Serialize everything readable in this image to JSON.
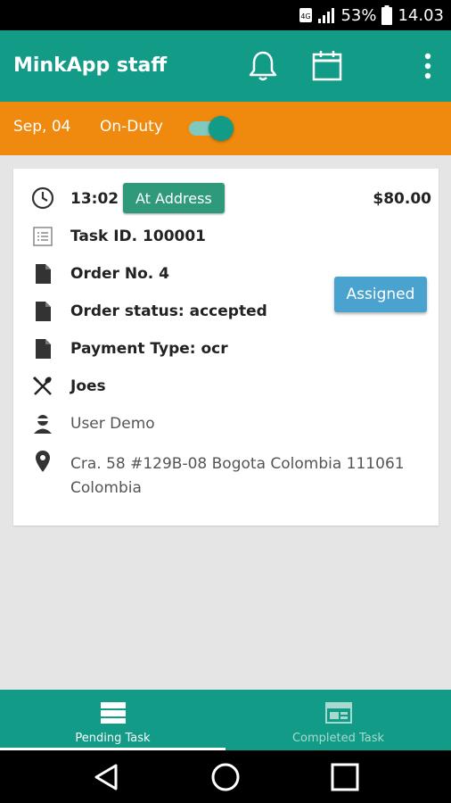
{
  "status_bar": {
    "battery_percent": "53%",
    "time": "14.03"
  },
  "app_bar": {
    "title": "MinkApp staff"
  },
  "duty_bar": {
    "date": "Sep, 04",
    "label": "On-Duty",
    "on_duty": true
  },
  "task": {
    "time": "13:02",
    "status_badge": "At Address",
    "price": "$80.00",
    "task_id": "Task ID. 100001",
    "order_no": "Order No. 4",
    "order_status": "Order status: accepted",
    "payment_type": "Payment Type: ocr",
    "restaurant": "Joes",
    "customer": "User Demo",
    "address_line1": "Cra. 58 #129B-08 Bogota Colombia 111061",
    "address_line2": "Colombia",
    "assigned_label": "Assigned"
  },
  "bottom_nav": {
    "tabs": [
      {
        "label": "Pending Task",
        "active": true
      },
      {
        "label": "Completed Task",
        "active": false
      }
    ]
  },
  "colors": {
    "primary": "#129b87",
    "duty_bar": "#f08a0e",
    "badge": "#2e9a7b",
    "assigned": "#4aa3cf"
  }
}
